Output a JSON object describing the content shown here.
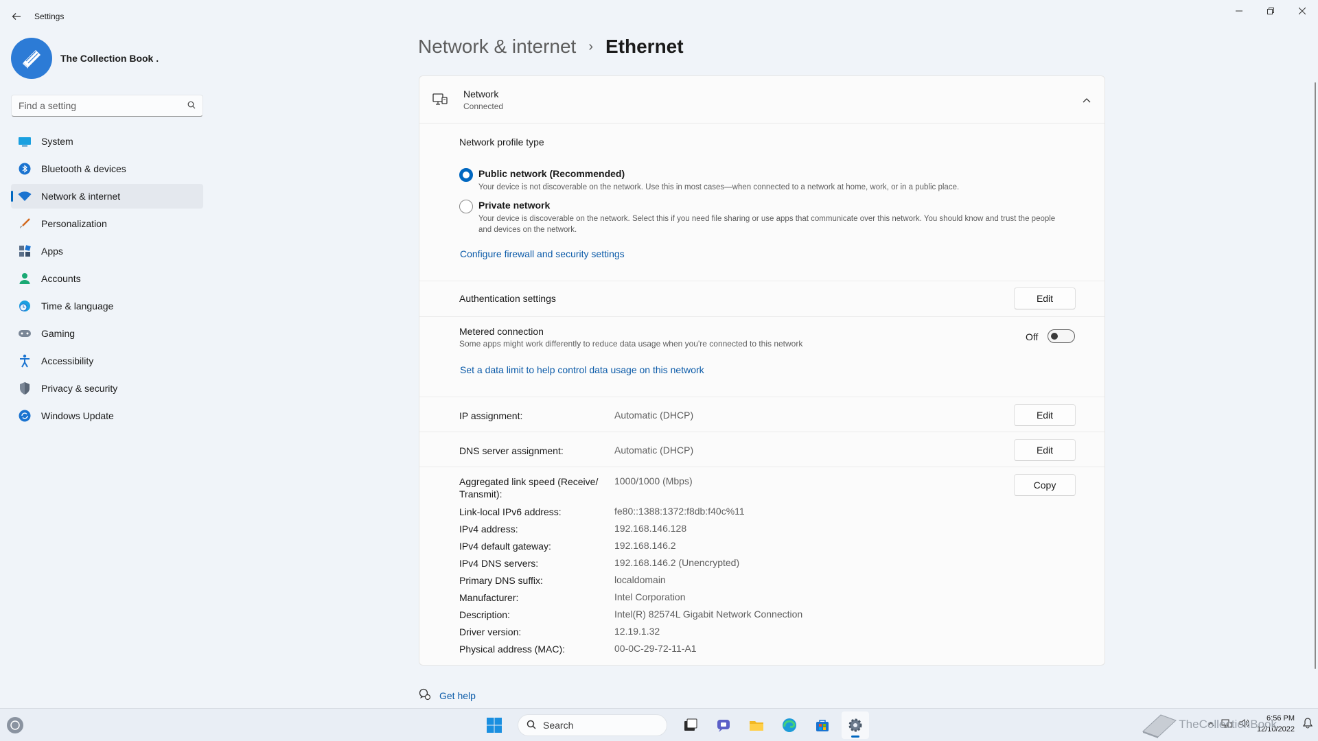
{
  "app": {
    "title": "Settings"
  },
  "profile": {
    "name": "The Collection Book ."
  },
  "search": {
    "placeholder": "Find a setting"
  },
  "nav": [
    {
      "label": "System",
      "icon": "monitor-icon"
    },
    {
      "label": "Bluetooth & devices",
      "icon": "bluetooth-icon"
    },
    {
      "label": "Network & internet",
      "icon": "wifi-icon",
      "active": true
    },
    {
      "label": "Personalization",
      "icon": "brush-icon"
    },
    {
      "label": "Apps",
      "icon": "apps-icon"
    },
    {
      "label": "Accounts",
      "icon": "person-icon"
    },
    {
      "label": "Time & language",
      "icon": "clock-globe-icon"
    },
    {
      "label": "Gaming",
      "icon": "gamepad-icon"
    },
    {
      "label": "Accessibility",
      "icon": "accessibility-icon"
    },
    {
      "label": "Privacy & security",
      "icon": "shield-icon"
    },
    {
      "label": "Windows Update",
      "icon": "refresh-icon"
    }
  ],
  "breadcrumb": {
    "parent": "Network & internet",
    "separator": "›",
    "current": "Ethernet"
  },
  "card": {
    "title": "Network",
    "subtitle": "Connected",
    "profile_type_label": "Network profile type",
    "public": {
      "title": "Public network (Recommended)",
      "desc": "Your device is not discoverable on the network. Use this in most cases—when connected to a network at home, work, or in a public place.",
      "checked": true
    },
    "private": {
      "title": "Private network",
      "desc": "Your device is discoverable on the network. Select this if you need file sharing or use apps that communicate over this network. You should know and trust the people and devices on the network.",
      "checked": false
    },
    "firewall_link": "Configure firewall and security settings",
    "auth_label": "Authentication settings",
    "edit_label": "Edit",
    "metered": {
      "title": "Metered connection",
      "desc": "Some apps might work differently to reduce data usage when you're connected to this network",
      "state": "Off"
    },
    "data_limit_link": "Set a data limit to help control data usage on this network",
    "ip_assignment": {
      "label": "IP assignment:",
      "value": "Automatic (DHCP)"
    },
    "dns_assignment": {
      "label": "DNS server assignment:",
      "value": "Automatic (DHCP)"
    },
    "copy_label": "Copy",
    "properties": [
      {
        "label": "Aggregated link speed (Receive/ Transmit):",
        "value": "1000/1000 (Mbps)"
      },
      {
        "label": "Link-local IPv6 address:",
        "value": "fe80::1388:1372:f8db:f40c%11"
      },
      {
        "label": "IPv4 address:",
        "value": "192.168.146.128"
      },
      {
        "label": "IPv4 default gateway:",
        "value": "192.168.146.2"
      },
      {
        "label": "IPv4 DNS servers:",
        "value": "192.168.146.2 (Unencrypted)"
      },
      {
        "label": "Primary DNS suffix:",
        "value": "localdomain"
      },
      {
        "label": "Manufacturer:",
        "value": "Intel Corporation"
      },
      {
        "label": "Description:",
        "value": "Intel(R) 82574L Gigabit Network Connection"
      },
      {
        "label": "Driver version:",
        "value": "12.19.1.32"
      },
      {
        "label": "Physical address (MAC):",
        "value": "00-0C-29-72-11-A1"
      }
    ]
  },
  "help": {
    "label": "Get help"
  },
  "taskbar": {
    "search_label": "Search",
    "time": "6:56 PM",
    "date": "12/10/2022",
    "watermark": "TheCollectionBook"
  },
  "colors": {
    "accent": "#0067c0",
    "link": "#0a5aa8",
    "background": "#f0f4f9"
  }
}
